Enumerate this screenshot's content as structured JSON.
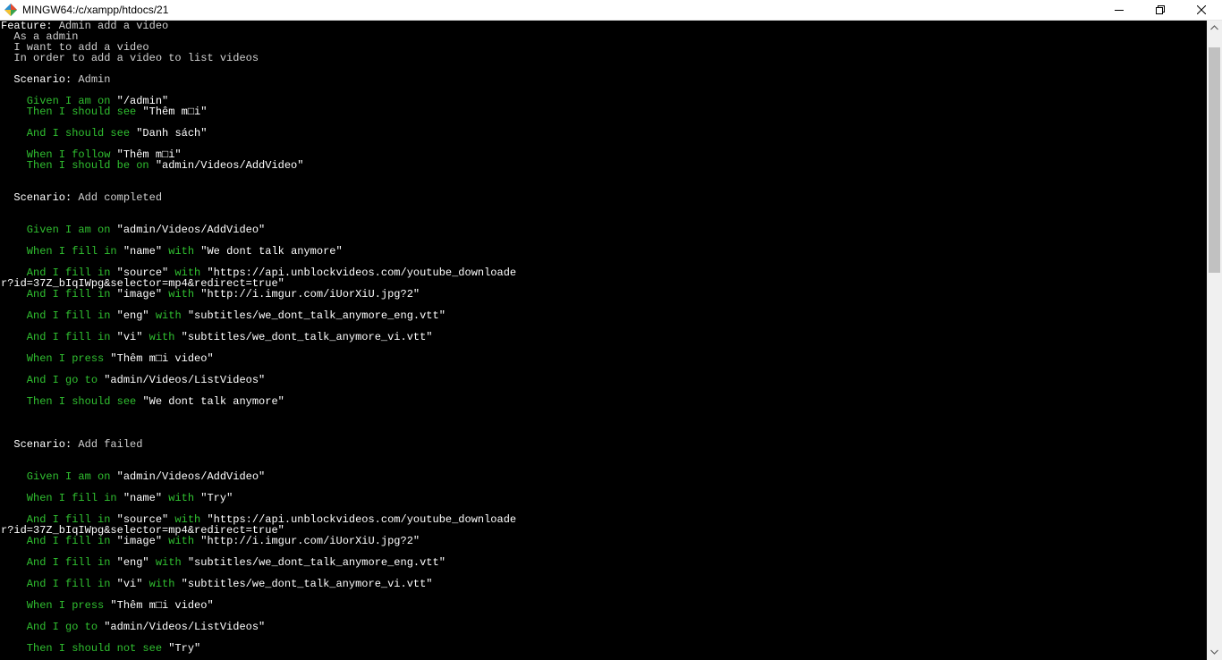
{
  "window": {
    "title": "MINGW64:/c/xampp/htdocs/21",
    "icon": "mingw-terminal-icon",
    "controls": [
      "minimize-icon",
      "maximize-icon",
      "close-icon"
    ]
  },
  "colors": {
    "background": "#000000",
    "text": "#d0d0d0",
    "keyword": "#ffffff",
    "step": "#30c030",
    "string": "#ffffff"
  },
  "terminal": {
    "lines": [
      {
        "kw": "Feature:",
        "rest": " Admin add a video"
      },
      {
        "text": "  As a admin"
      },
      {
        "text": "  I want to add a video"
      },
      {
        "text": "  In order to add a video to list videos"
      },
      {
        "text": ""
      },
      {
        "kw": "  Scenario:",
        "rest": " Admin"
      },
      {
        "text": ""
      },
      {
        "step": "    Given I am on ",
        "str": "\"/admin\""
      },
      {
        "step": "    Then I should see ",
        "str": "\"Thêm m□i\""
      },
      {
        "text": ""
      },
      {
        "step": "    And I should see ",
        "str": "\"Danh sách\""
      },
      {
        "text": ""
      },
      {
        "step": "    When I follow ",
        "str": "\"Thêm m□i\""
      },
      {
        "step": "    Then I should be on ",
        "str": "\"admin/Videos/AddVideo\""
      },
      {
        "text": ""
      },
      {
        "text": ""
      },
      {
        "kw": "  Scenario:",
        "rest": " Add completed"
      },
      {
        "text": ""
      },
      {
        "text": ""
      },
      {
        "step": "    Given I am on ",
        "str": "\"admin/Videos/AddVideo\""
      },
      {
        "text": ""
      },
      {
        "step": "    When I fill in ",
        "str": "\"name\"",
        "step2": " with ",
        "str2": "\"We dont talk anymore\""
      },
      {
        "text": ""
      },
      {
        "step": "    And I fill in ",
        "str": "\"source\"",
        "step2": " with ",
        "str2": "\"https://api.unblockvideos.com/youtube_downloade"
      },
      {
        "str": "r?id=37Z_bIqIWpg&selector=mp4&redirect=true\""
      },
      {
        "step": "    And I fill in ",
        "str": "\"image\"",
        "step2": " with ",
        "str2": "\"http://i.imgur.com/iUorXiU.jpg?2\""
      },
      {
        "text": ""
      },
      {
        "step": "    And I fill in ",
        "str": "\"eng\"",
        "step2": " with ",
        "str2": "\"subtitles/we_dont_talk_anymore_eng.vtt\""
      },
      {
        "text": ""
      },
      {
        "step": "    And I fill in ",
        "str": "\"vi\"",
        "step2": " with ",
        "str2": "\"subtitles/we_dont_talk_anymore_vi.vtt\""
      },
      {
        "text": ""
      },
      {
        "step": "    When I press ",
        "str": "\"Thêm m□i video\""
      },
      {
        "text": ""
      },
      {
        "step": "    And I go to ",
        "str": "\"admin/Videos/ListVideos\""
      },
      {
        "text": ""
      },
      {
        "step": "    Then I should see ",
        "str": "\"We dont talk anymore\""
      },
      {
        "text": ""
      },
      {
        "text": ""
      },
      {
        "text": ""
      },
      {
        "kw": "  Scenario:",
        "rest": " Add failed"
      },
      {
        "text": ""
      },
      {
        "text": ""
      },
      {
        "step": "    Given I am on ",
        "str": "\"admin/Videos/AddVideo\""
      },
      {
        "text": ""
      },
      {
        "step": "    When I fill in ",
        "str": "\"name\"",
        "step2": " with ",
        "str2": "\"Try\""
      },
      {
        "text": ""
      },
      {
        "step": "    And I fill in ",
        "str": "\"source\"",
        "step2": " with ",
        "str2": "\"https://api.unblockvideos.com/youtube_downloade"
      },
      {
        "str": "r?id=37Z_bIqIWpg&selector=mp4&redirect=true\""
      },
      {
        "step": "    And I fill in ",
        "str": "\"image\"",
        "step2": " with ",
        "str2": "\"http://i.imgur.com/iUorXiU.jpg?2\""
      },
      {
        "text": ""
      },
      {
        "step": "    And I fill in ",
        "str": "\"eng\"",
        "step2": " with ",
        "str2": "\"subtitles/we_dont_talk_anymore_eng.vtt\""
      },
      {
        "text": ""
      },
      {
        "step": "    And I fill in ",
        "str": "\"vi\"",
        "step2": " with ",
        "str2": "\"subtitles/we_dont_talk_anymore_vi.vtt\""
      },
      {
        "text": ""
      },
      {
        "step": "    When I press ",
        "str": "\"Thêm m□i video\""
      },
      {
        "text": ""
      },
      {
        "step": "    And I go to ",
        "str": "\"admin/Videos/ListVideos\""
      },
      {
        "text": ""
      },
      {
        "step": "    Then I should not see ",
        "str": "\"Try\""
      }
    ]
  },
  "scrollbar": {
    "icons": [
      "scroll-up-arrow-icon",
      "scroll-down-arrow-icon"
    ]
  }
}
